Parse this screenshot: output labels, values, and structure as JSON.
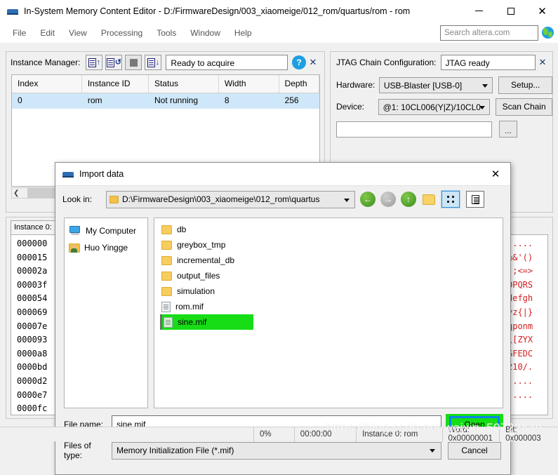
{
  "window": {
    "title": "In-System Memory Content Editor - D:/FirmwareDesign/003_xiaomeige/012_rom/quartus/rom - rom",
    "app_icon": "memory-chip-icon",
    "minimize": "—",
    "maximize": "□",
    "close": "✕"
  },
  "menu": {
    "items": [
      "File",
      "Edit",
      "View",
      "Processing",
      "Tools",
      "Window",
      "Help"
    ],
    "search_placeholder": "Search altera.com",
    "search_value": "Search altera.com",
    "globe_icon": "globe-icon"
  },
  "instance_manager": {
    "label": "Instance Manager:",
    "status": "Ready to acquire",
    "help_label": "?",
    "close_label": "✕",
    "toolbar": [
      {
        "name": "read-data-from-memory-icon",
        "arrow": "↑"
      },
      {
        "name": "continuously-read-data-icon",
        "arrow": "↺"
      },
      {
        "name": "stop-acquisition-icon",
        "arrow": ""
      },
      {
        "name": "write-data-to-memory-icon",
        "arrow": "↓"
      }
    ],
    "columns": [
      "Index",
      "Instance ID",
      "Status",
      "Width",
      "Depth"
    ],
    "rows": [
      {
        "index": "0",
        "instance_id": "rom",
        "status": "Not running",
        "width": "8",
        "depth": "256"
      }
    ]
  },
  "jtag": {
    "label": "JTAG Chain Configuration:",
    "status": "JTAG ready",
    "close_label": "✕",
    "hardware_label": "Hardware:",
    "hardware_value": "USB-Blaster [USB-0]",
    "setup_label": "Setup...",
    "device_label": "Device:",
    "device_value": "@1: 10CL006(Y|Z)/10CL0",
    "scan_label": "Scan Chain",
    "browse_label": "..."
  },
  "hex_editor": {
    "tab_label": "Instance 0:",
    "addresses": [
      "000000",
      "000015",
      "00002a",
      "00003f",
      "000054",
      "000069",
      "00007e",
      "000093",
      "0000a8",
      "0000bd",
      "0000d2",
      "0000e7",
      "0000fc"
    ],
    "ascii": [
      ".....",
      "%&'()",
      ":;<=>",
      "OPQRS",
      "defgh",
      "yz{|}",
      "qponm",
      "\\[ZYX",
      "GFEDC",
      "210/.",
      ".....",
      "....."
    ],
    "ascii_color": "#d42020"
  },
  "dialog": {
    "title": "Import data",
    "icon": "memory-chip-icon",
    "close_label": "✕",
    "look_in_label": "Look in:",
    "look_in_value": "D:\\FirmwareDesign\\003_xiaomeige\\012_rom\\quartus",
    "nav": [
      {
        "name": "back-icon",
        "glyph": "←",
        "enabled": true
      },
      {
        "name": "forward-icon",
        "glyph": "→",
        "enabled": false
      },
      {
        "name": "up-one-level-icon",
        "glyph": "↑",
        "enabled": true
      }
    ],
    "new_folder_icon": "new-folder-icon",
    "list_view_icon": "list-view-icon",
    "detail_view_icon": "detail-view-icon",
    "places": [
      {
        "label": "My Computer",
        "icon": "computer-icon"
      },
      {
        "label": "Huo Yingge",
        "icon": "user-folder-icon"
      }
    ],
    "files": [
      {
        "name": "db",
        "type": "folder",
        "selected": false
      },
      {
        "name": "greybox_tmp",
        "type": "folder",
        "selected": false
      },
      {
        "name": "incremental_db",
        "type": "folder",
        "selected": false
      },
      {
        "name": "output_files",
        "type": "folder",
        "selected": false
      },
      {
        "name": "simulation",
        "type": "folder",
        "selected": false
      },
      {
        "name": "rom.mif",
        "type": "file",
        "selected": false
      },
      {
        "name": "sine.mif",
        "type": "file",
        "selected": true
      }
    ],
    "file_name_label": "File name:",
    "file_name_value": "sine.mif",
    "files_of_type_label": "Files of type:",
    "files_of_type_value": "Memory Initialization File (*.mif)",
    "open_label": "Open",
    "cancel_label": "Cancel",
    "highlight_color": "#16dd16",
    "focus_border_color": "#0b84e8"
  },
  "statusbar": {
    "progress": "0%",
    "elapsed": "00:00:00",
    "instance": "Instance 0: rom",
    "word": "Word: 0x00000001",
    "bit": "Bit: 0x000003"
  },
  "watermark": "https://blog.csdn.net/weixin_50722839"
}
